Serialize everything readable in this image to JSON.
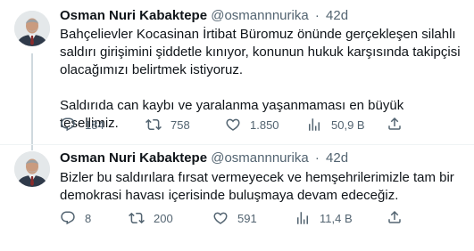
{
  "tweets": [
    {
      "author_name": "Osman Nuri Kabaktepe",
      "handle": "@osmannnurika",
      "separator": "·",
      "time": "42d",
      "paragraphs": [
        "Bahçelievler Kocasinan İrtibat Büromuz önünde gerçekleşen silahlı saldırı girişimini şiddetle kınıyor, konunun hukuk karşısında takipçisi olacağımızı belirtmek istiyoruz.",
        "Saldırıda can kaybı ve yaralanma yaşanmaması en büyük tesellimiz."
      ],
      "replies": "184",
      "retweets": "758",
      "likes": "1.850",
      "views": "50,9 B"
    },
    {
      "author_name": "Osman Nuri Kabaktepe",
      "handle": "@osmannnurika",
      "separator": "·",
      "time": "42d",
      "paragraphs": [
        "Bizler bu saldırılara fırsat vermeyecek ve hemşehrilerimizle tam bir demokrasi havası içerisinde buluşmaya devam edeceğiz."
      ],
      "replies": "8",
      "retweets": "200",
      "likes": "591",
      "views": "11,4 B"
    }
  ],
  "icons": {
    "reply": "reply-icon",
    "retweet": "retweet-icon",
    "like": "heart-icon",
    "views": "views-icon",
    "share": "share-icon"
  },
  "colors": {
    "text": "#0f1419",
    "secondary": "#536471",
    "divider": "#eff3f4",
    "thread_line": "#cfd9de"
  }
}
